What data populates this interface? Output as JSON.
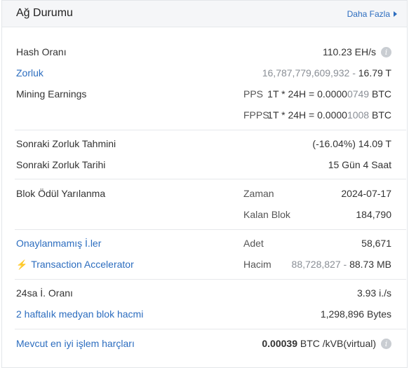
{
  "header": {
    "title": "Ağ Durumu",
    "more_label": "Daha Fazla"
  },
  "hash": {
    "label": "Hash Oranı",
    "value": "110.23 EH/s"
  },
  "difficulty": {
    "label": "Zorluk",
    "value_full": "16,787,779,609,932",
    "sep": " - ",
    "value_short": "16.79 T"
  },
  "mining": {
    "label": "Mining Earnings",
    "pps": {
      "label": "PPS",
      "prefix": "1T * 24H = 0.0000",
      "highlight": "0749",
      "unit": " BTC"
    },
    "fpps": {
      "label": "FPPS",
      "prefix": "1T * 24H = 0.0000",
      "highlight": "1008",
      "unit": " BTC"
    }
  },
  "next_difficulty": {
    "label": "Sonraki Zorluk Tahmini",
    "value": "(-16.04%) 14.09 T"
  },
  "next_date": {
    "label": "Sonraki Zorluk Tarihi",
    "value": "15 Gün 4 Saat"
  },
  "halving": {
    "label": "Blok Ödül Yarılanma",
    "time_label": "Zaman",
    "time_value": "2024-07-17",
    "blocks_label": "Kalan Blok",
    "blocks_value": "184,790"
  },
  "unconfirmed": {
    "label": "Onaylanmamış İ.ler",
    "count_label": "Adet",
    "count_value": "58,671",
    "accelerator_label": "Transaction Accelerator",
    "volume_label": "Hacim",
    "volume_full": "88,728,827",
    "volume_sep": " - ",
    "volume_short": "88.73 MB"
  },
  "tx_rate": {
    "label": "24sa İ. Oranı",
    "value": "3.93 i./s"
  },
  "median_block": {
    "label": "2 haftalık medyan blok hacmi",
    "value": "1,298,896 Bytes"
  },
  "best_fee": {
    "label": "Mevcut en iyi işlem harçları",
    "value_bold": "0.00039",
    "value_unit": " BTC /kVB(virtual)"
  },
  "colors": {
    "link": "#2c6dbf",
    "muted": "#8a8f96",
    "header_bg": "#f5f6f8"
  },
  "icons": {
    "info": "info-icon",
    "more": "caret-right-icon",
    "accelerator": "lightning-bolt-icon"
  }
}
